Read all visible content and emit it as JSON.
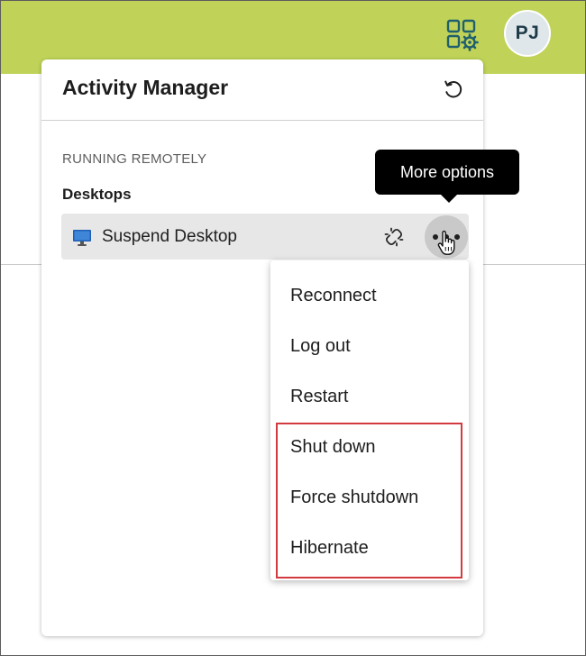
{
  "header": {
    "avatar_initials": "PJ",
    "apps_icon": "apps-settings-icon",
    "bar_color": "#c0d358"
  },
  "panel": {
    "title": "Activity Manager",
    "refresh_icon": "refresh-icon",
    "section_label": "RUNNING REMOTELY",
    "group_label": "Desktops",
    "desktop": {
      "icon": "monitor-icon",
      "name": "Suspend Desktop",
      "disconnect_icon": "broken-link-icon",
      "more_icon": "ellipsis-icon"
    }
  },
  "tooltip": {
    "text": "More options"
  },
  "menu": {
    "items": [
      {
        "label": "Reconnect"
      },
      {
        "label": "Log out"
      },
      {
        "label": "Restart"
      },
      {
        "label": "Shut down"
      },
      {
        "label": "Force shutdown"
      },
      {
        "label": "Hibernate"
      }
    ],
    "highlight_color": "#d33a3f"
  }
}
